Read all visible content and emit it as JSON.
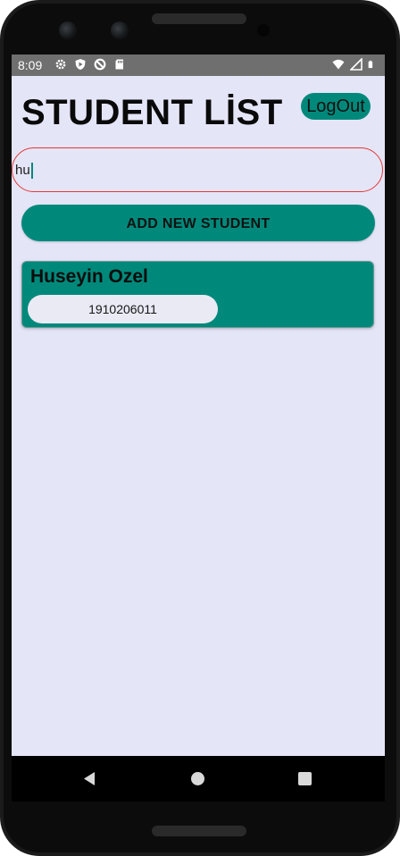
{
  "statusbar": {
    "time": "8:09",
    "left_icons": [
      "settings-icon",
      "shield-play-icon",
      "data-saver-icon",
      "sd-card-icon"
    ],
    "right_icons": [
      "wifi-icon",
      "signal-icon",
      "battery-icon"
    ]
  },
  "header": {
    "title": "STUDENT LİST",
    "logout_label": "LogOut"
  },
  "search": {
    "value": "hu"
  },
  "actions": {
    "add_label": "ADD NEW STUDENT"
  },
  "students": [
    {
      "name": "Huseyin Ozel",
      "number": "1910206011"
    }
  ],
  "colors": {
    "accent": "#00897b",
    "background": "#e5e5f8",
    "search_border": "#e53935"
  },
  "navbar": {
    "icons": [
      "back-icon",
      "home-icon",
      "recents-icon"
    ]
  }
}
